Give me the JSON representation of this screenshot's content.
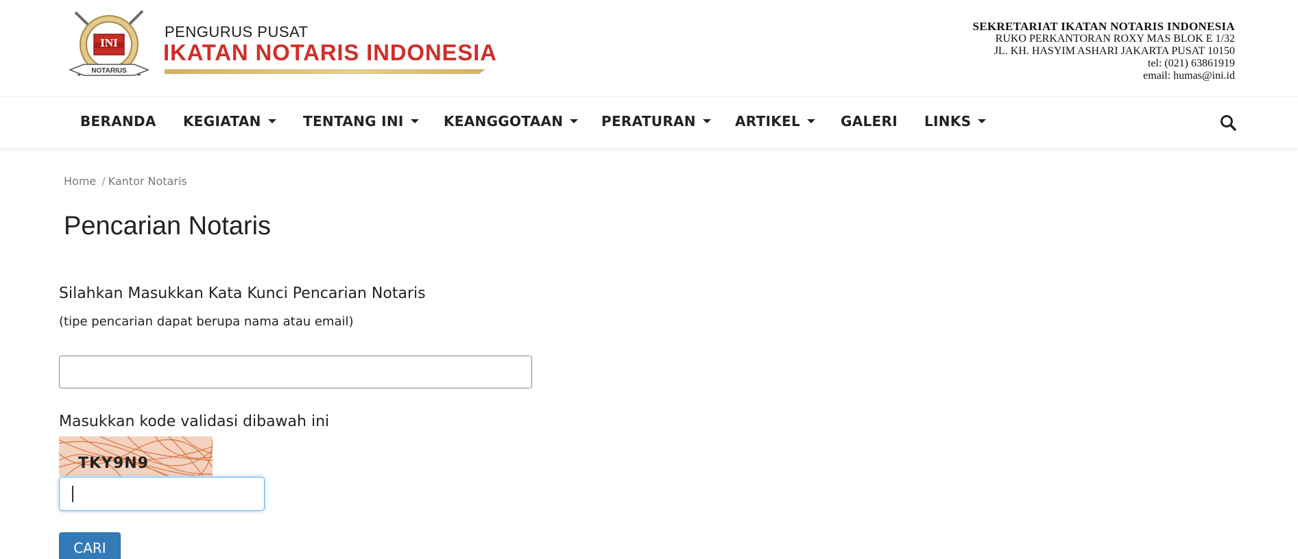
{
  "header": {
    "brand_top": "PENGURUS PUSAT",
    "brand_main": "IKATAN NOTARIS INDONESIA",
    "emblem_text": "INI",
    "emblem_ribbon": "NOTARIUS",
    "contact": {
      "title": "SEKRETARIAT IKATAN NOTARIS INDONESIA",
      "address1": "RUKO PERKANTORAN ROXY MAS  BLOK E 1/32",
      "address2": "JL. KH. HASYIM ASHARI  JAKARTA PUSAT 10150",
      "tel": "tel: (021) 63861919",
      "email": "email: humas@ini.id"
    },
    "brand_color": "#cf2f2a",
    "gold_color": "#d4b066"
  },
  "nav": {
    "items": [
      {
        "label": "BERANDA",
        "dropdown": false
      },
      {
        "label": "KEGIATAN",
        "dropdown": true
      },
      {
        "label": "TENTANG INI",
        "dropdown": true
      },
      {
        "label": "KEANGGOTAAN",
        "dropdown": true
      },
      {
        "label": "PERATURAN",
        "dropdown": true
      },
      {
        "label": "ARTIKEL",
        "dropdown": true
      },
      {
        "label": "GALERI",
        "dropdown": false
      },
      {
        "label": "LINKS",
        "dropdown": true
      }
    ],
    "search_icon": "search-icon"
  },
  "breadcrumb": {
    "home": "Home",
    "separator": "/",
    "current": "Kantor Notaris"
  },
  "page": {
    "title": "Pencarian Notaris"
  },
  "form": {
    "search_label": "Silahkan Masukkan Kata Kunci Pencarian Notaris",
    "search_hint": "(tipe pencarian dapat berupa nama atau email)",
    "search_value": "",
    "code_label": "Masukkan kode validasi dibawah ini",
    "captcha_text": "TKY9N9",
    "code_value": "",
    "submit_label": "CARI",
    "button_color": "#337ab7",
    "focus_color": "#66afe9"
  }
}
